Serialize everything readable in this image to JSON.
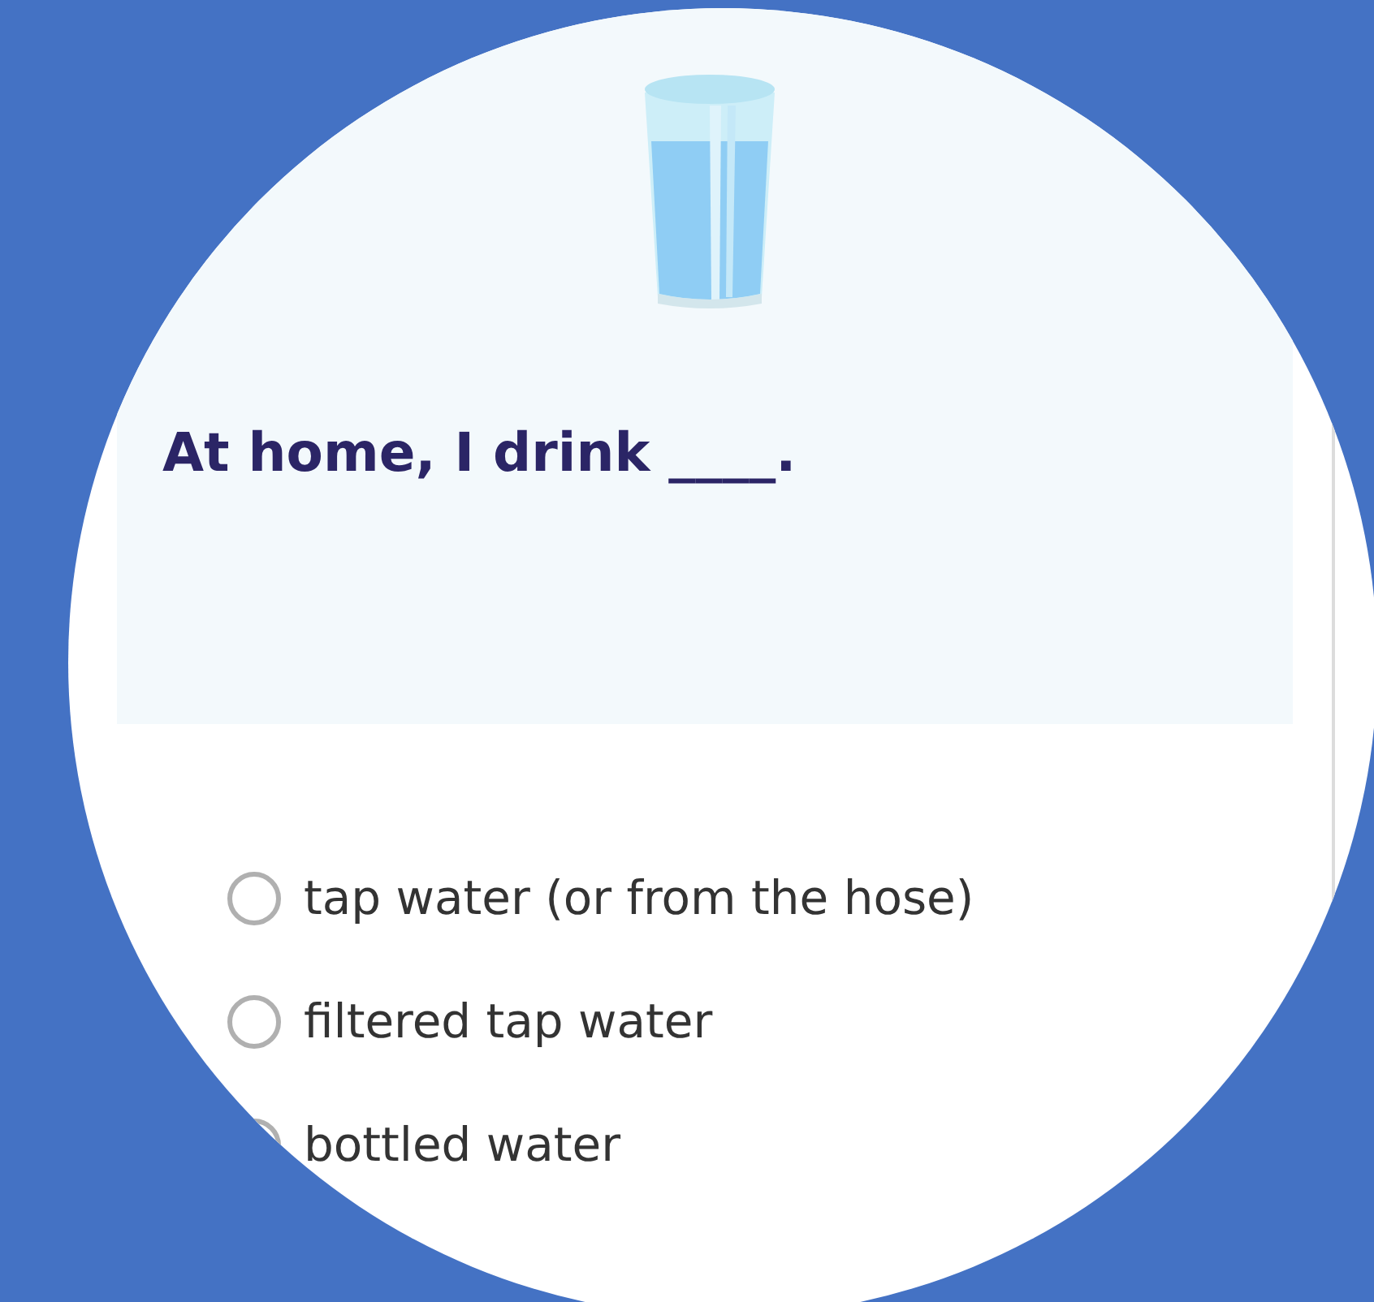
{
  "question": {
    "text": "At home, I drink ____."
  },
  "options": [
    {
      "label": "tap water (or from the hose)",
      "selected": false
    },
    {
      "label": "filtered tap water",
      "selected": false
    },
    {
      "label": "bottled water",
      "selected": false
    }
  ]
}
